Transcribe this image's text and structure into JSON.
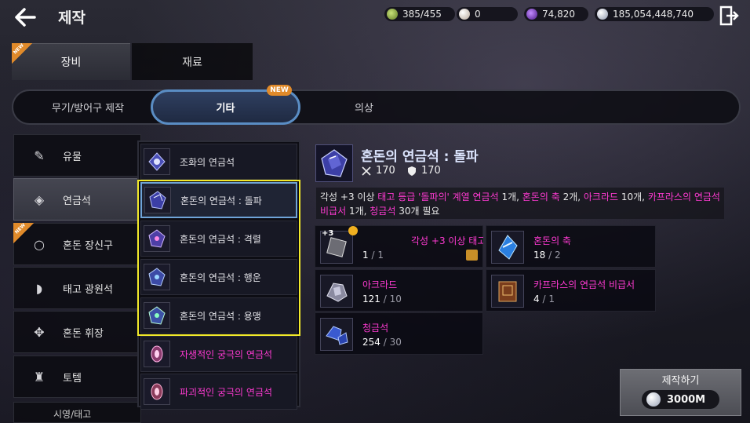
{
  "header": {
    "title": "제작",
    "resources": {
      "energy": "385/455",
      "pearl": "0",
      "purple": "74,820",
      "silver": "185,054,448,740"
    }
  },
  "main_tabs": {
    "equipment": "장비",
    "materials": "재료",
    "new_label": "NEW"
  },
  "sub_tabs": {
    "weapons": "무기/방어구 제작",
    "etc": "기타",
    "outfit": "의상",
    "new_badge": "NEW"
  },
  "sidebar": {
    "items": [
      {
        "label": "유물"
      },
      {
        "label": "연금석"
      },
      {
        "label": "혼돈 장신구"
      },
      {
        "label": "태고 광원석"
      },
      {
        "label": "혼돈 휘장"
      },
      {
        "label": "토템"
      }
    ],
    "cut_label": "시영/태고"
  },
  "recipes": [
    {
      "label": "조화의 연금석"
    },
    {
      "label": "혼돈의 연금석 : 돌파"
    },
    {
      "label": "혼돈의 연금석 : 격렬"
    },
    {
      "label": "혼돈의 연금석 : 행운"
    },
    {
      "label": "혼돈의 연금석 : 용맹"
    },
    {
      "label": "자생적인 궁극의 연금석"
    },
    {
      "label": "파괴적인 궁극의 연금석"
    }
  ],
  "detail": {
    "title": "혼돈의 연금석 : 돌파",
    "attack": "170",
    "defense": "170",
    "desc": {
      "p1": "각성 +3 이상 ",
      "h1": "태고 등급 '돌파의' 계열 연금석",
      "p2": " 1개, ",
      "h2": "혼돈의 축",
      "p3": " 2개, ",
      "h3": "아크라드",
      "p4": " 10개, ",
      "h4": "카프라스의 연금석 비급서",
      "p5": " 1개, ",
      "h5": "청금석",
      "p6": " 30개 필요"
    }
  },
  "materials": [
    {
      "name": "각성 +3 이상 태고",
      "have": "1",
      "need": "1",
      "badge": "+3"
    },
    {
      "name": "혼돈의 축",
      "have": "18",
      "need": "2"
    },
    {
      "name": "아크라드",
      "have": "121",
      "need": "10"
    },
    {
      "name": "카프라스의 연금석 비급서",
      "have": "4",
      "need": "1"
    },
    {
      "name": "청금석",
      "have": "254",
      "need": "30"
    }
  ],
  "craft": {
    "label": "제작하기",
    "cost": "3000M"
  },
  "colors": {
    "accent_blue": "#5a8dc4",
    "highlight_pink": "#ff3ad2",
    "selection_yellow": "#f2ea2b",
    "new_orange": "#e08a2a"
  }
}
